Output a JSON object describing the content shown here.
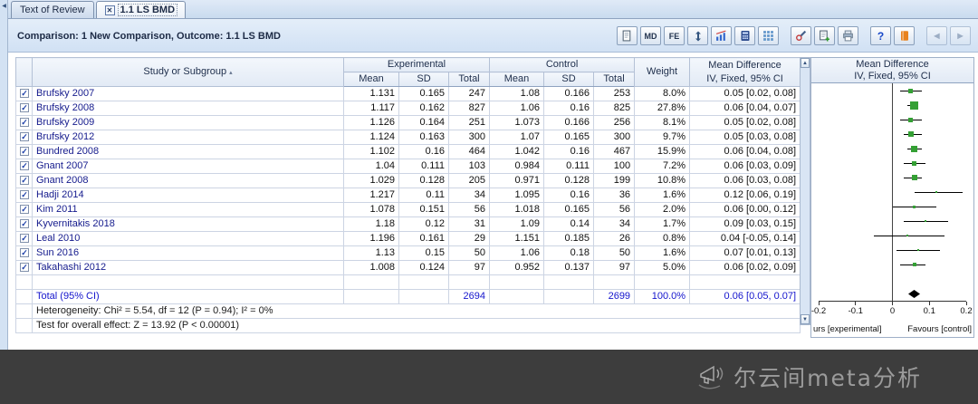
{
  "tabs": [
    {
      "label": "Text of Review",
      "active": false
    },
    {
      "label": "1.1 LS BMD",
      "active": true
    }
  ],
  "header": {
    "comparison": "Comparison: 1 New Comparison, Outcome: 1.1 LS BMD"
  },
  "toolbar": {
    "md_label": "MD",
    "fe_label": "FE",
    "help_label": "?",
    "prev_arrow": "◀",
    "next_arrow": "▶"
  },
  "table": {
    "headers": {
      "study": "Study or Subgroup",
      "experimental": "Experimental",
      "control": "Control",
      "weight": "Weight",
      "md_title": "Mean Difference",
      "md_subtitle": "IV, Fixed, 95% CI",
      "mean": "Mean",
      "sd": "SD",
      "total": "Total"
    },
    "rows": [
      {
        "checked": true,
        "study": "Brufsky 2007",
        "e_mean": "1.131",
        "e_sd": "0.165",
        "e_total": "247",
        "c_mean": "1.08",
        "c_sd": "0.166",
        "c_total": "253",
        "weight": "8.0%",
        "md_text": "0.05 [0.02, 0.08]"
      },
      {
        "checked": true,
        "study": "Brufsky 2008",
        "e_mean": "1.117",
        "e_sd": "0.162",
        "e_total": "827",
        "c_mean": "1.06",
        "c_sd": "0.16",
        "c_total": "825",
        "weight": "27.8%",
        "md_text": "0.06 [0.04, 0.07]"
      },
      {
        "checked": true,
        "study": "Brufsky 2009",
        "e_mean": "1.126",
        "e_sd": "0.164",
        "e_total": "251",
        "c_mean": "1.073",
        "c_sd": "0.166",
        "c_total": "256",
        "weight": "8.1%",
        "md_text": "0.05 [0.02, 0.08]"
      },
      {
        "checked": true,
        "study": "Brufsky 2012",
        "e_mean": "1.124",
        "e_sd": "0.163",
        "e_total": "300",
        "c_mean": "1.07",
        "c_sd": "0.165",
        "c_total": "300",
        "weight": "9.7%",
        "md_text": "0.05 [0.03, 0.08]"
      },
      {
        "checked": true,
        "study": "Bundred 2008",
        "e_mean": "1.102",
        "e_sd": "0.16",
        "e_total": "464",
        "c_mean": "1.042",
        "c_sd": "0.16",
        "c_total": "467",
        "weight": "15.9%",
        "md_text": "0.06 [0.04, 0.08]"
      },
      {
        "checked": true,
        "study": "Gnant 2007",
        "e_mean": "1.04",
        "e_sd": "0.111",
        "e_total": "103",
        "c_mean": "0.984",
        "c_sd": "0.111",
        "c_total": "100",
        "weight": "7.2%",
        "md_text": "0.06 [0.03, 0.09]"
      },
      {
        "checked": true,
        "study": "Gnant 2008",
        "e_mean": "1.029",
        "e_sd": "0.128",
        "e_total": "205",
        "c_mean": "0.971",
        "c_sd": "0.128",
        "c_total": "199",
        "weight": "10.8%",
        "md_text": "0.06 [0.03, 0.08]"
      },
      {
        "checked": true,
        "study": "Hadji 2014",
        "e_mean": "1.217",
        "e_sd": "0.11",
        "e_total": "34",
        "c_mean": "1.095",
        "c_sd": "0.16",
        "c_total": "36",
        "weight": "1.6%",
        "md_text": "0.12 [0.06, 0.19]"
      },
      {
        "checked": true,
        "study": "Kim 2011",
        "e_mean": "1.078",
        "e_sd": "0.151",
        "e_total": "56",
        "c_mean": "1.018",
        "c_sd": "0.165",
        "c_total": "56",
        "weight": "2.0%",
        "md_text": "0.06 [0.00, 0.12]"
      },
      {
        "checked": true,
        "study": "Kyvernitakis 2018",
        "e_mean": "1.18",
        "e_sd": "0.12",
        "e_total": "31",
        "c_mean": "1.09",
        "c_sd": "0.14",
        "c_total": "34",
        "weight": "1.7%",
        "md_text": "0.09 [0.03, 0.15]"
      },
      {
        "checked": true,
        "study": "Leal 2010",
        "e_mean": "1.196",
        "e_sd": "0.161",
        "e_total": "29",
        "c_mean": "1.151",
        "c_sd": "0.185",
        "c_total": "26",
        "weight": "0.8%",
        "md_text": "0.04 [-0.05, 0.14]"
      },
      {
        "checked": true,
        "study": "Sun 2016",
        "e_mean": "1.13",
        "e_sd": "0.15",
        "e_total": "50",
        "c_mean": "1.06",
        "c_sd": "0.18",
        "c_total": "50",
        "weight": "1.6%",
        "md_text": "0.07 [0.01, 0.13]"
      },
      {
        "checked": true,
        "study": "Takahashi 2012",
        "e_mean": "1.008",
        "e_sd": "0.124",
        "e_total": "97",
        "c_mean": "0.952",
        "c_sd": "0.137",
        "c_total": "97",
        "weight": "5.0%",
        "md_text": "0.06 [0.02, 0.09]"
      }
    ],
    "total_row": {
      "label": "Total (95% CI)",
      "e_total": "2694",
      "c_total": "2699",
      "weight": "100.0%",
      "md_text": "0.06 [0.05, 0.07]"
    },
    "heterogeneity": "Heterogeneity: Chi² = 5.54, df = 12 (P = 0.94); I² = 0%",
    "overall_effect": "Test for overall effect: Z = 13.92 (P < 0.00001)"
  },
  "forest": {
    "title": "Mean Difference",
    "subtitle": "IV, Fixed, 95% CI",
    "xmin": -0.2,
    "xmax": 0.2,
    "ticks": [
      {
        "v": -0.2,
        "label": "-0.2"
      },
      {
        "v": -0.1,
        "label": "-0.1"
      },
      {
        "v": 0,
        "label": "0"
      },
      {
        "v": 0.1,
        "label": "0.1"
      },
      {
        "v": 0.2,
        "label": "0.2"
      }
    ],
    "favours_left": "urs [experimental]",
    "favours_right": "Favours [control]",
    "marker_color": "#34a034",
    "line_color": "#000000",
    "diamond_color": "#000000"
  },
  "chart_data": {
    "type": "scatter",
    "title": "Mean Difference",
    "subtitle": "IV, Fixed, 95% CI",
    "xlim": [
      -0.2,
      0.2
    ],
    "x_ticks": [
      -0.2,
      -0.1,
      0,
      0.1,
      0.2
    ],
    "x_label_left": "urs [experimental]",
    "x_label_right": "Favours [control]",
    "series": [
      {
        "name": "Brufsky 2007",
        "md": 0.05,
        "ci": [
          0.02,
          0.08
        ],
        "weight_pct": 8.0
      },
      {
        "name": "Brufsky 2008",
        "md": 0.06,
        "ci": [
          0.04,
          0.07
        ],
        "weight_pct": 27.8
      },
      {
        "name": "Brufsky 2009",
        "md": 0.05,
        "ci": [
          0.02,
          0.08
        ],
        "weight_pct": 8.1
      },
      {
        "name": "Brufsky 2012",
        "md": 0.05,
        "ci": [
          0.03,
          0.08
        ],
        "weight_pct": 9.7
      },
      {
        "name": "Bundred 2008",
        "md": 0.06,
        "ci": [
          0.04,
          0.08
        ],
        "weight_pct": 15.9
      },
      {
        "name": "Gnant 2007",
        "md": 0.06,
        "ci": [
          0.03,
          0.09
        ],
        "weight_pct": 7.2
      },
      {
        "name": "Gnant 2008",
        "md": 0.06,
        "ci": [
          0.03,
          0.08
        ],
        "weight_pct": 10.8
      },
      {
        "name": "Hadji 2014",
        "md": 0.12,
        "ci": [
          0.06,
          0.19
        ],
        "weight_pct": 1.6
      },
      {
        "name": "Kim 2011",
        "md": 0.06,
        "ci": [
          0.0,
          0.12
        ],
        "weight_pct": 2.0
      },
      {
        "name": "Kyvernitakis 2018",
        "md": 0.09,
        "ci": [
          0.03,
          0.15
        ],
        "weight_pct": 1.7
      },
      {
        "name": "Leal 2010",
        "md": 0.04,
        "ci": [
          -0.05,
          0.14
        ],
        "weight_pct": 0.8
      },
      {
        "name": "Sun 2016",
        "md": 0.07,
        "ci": [
          0.01,
          0.13
        ],
        "weight_pct": 1.6
      },
      {
        "name": "Takahashi 2012",
        "md": 0.06,
        "ci": [
          0.02,
          0.09
        ],
        "weight_pct": 5.0
      }
    ],
    "total": {
      "name": "Total (95% CI)",
      "md": 0.06,
      "ci": [
        0.05,
        0.07
      ],
      "weight_pct": 100.0
    }
  },
  "watermark": {
    "text": "尔云间meta分析"
  }
}
